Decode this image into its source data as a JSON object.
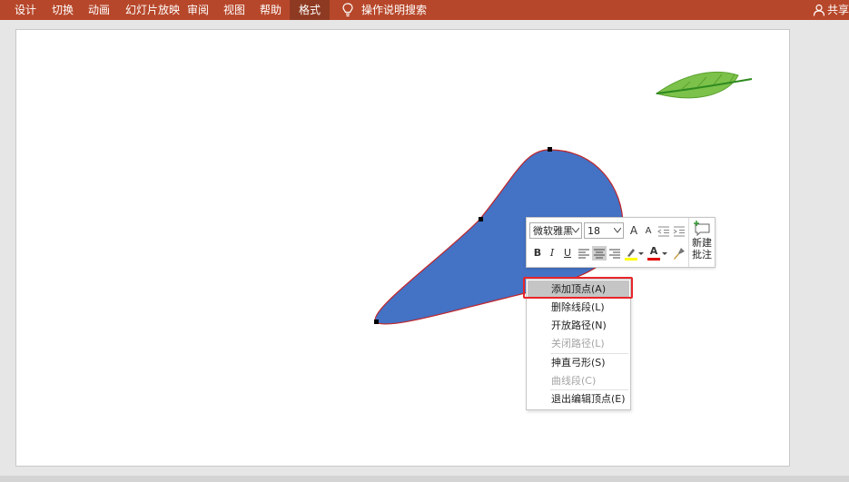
{
  "ribbon": {
    "tabs": [
      "设计",
      "切换",
      "动画",
      "幻灯片放映",
      "审阅",
      "视图",
      "帮助",
      "格式"
    ],
    "active_tab": "格式",
    "tell_me": "操作说明搜索",
    "share": "共享"
  },
  "colors": {
    "ribbon": "#b7472a",
    "shape_fill": "#4472c4",
    "shape_outline": "#c0262b",
    "highlight": "#e8262a",
    "leaf": "#7cc24a"
  },
  "mini_toolbar": {
    "font_name": "微软雅黑",
    "font_size": "18",
    "grow_font": "A",
    "shrink_font": "A",
    "bold": "B",
    "italic": "I",
    "underline": "U",
    "font_color": "A",
    "new_comment_line1": "新建",
    "new_comment_line2": "批注"
  },
  "context_menu": {
    "items": [
      {
        "label": "添加顶点(A)",
        "disabled": false,
        "hover": true
      },
      {
        "label": "删除线段(L)",
        "disabled": false
      },
      {
        "label": "开放路径(N)",
        "disabled": false
      },
      {
        "label": "关闭路径(L)",
        "disabled": true
      },
      {
        "label": "抻直弓形(S)",
        "disabled": false
      },
      {
        "label": "曲线段(C)",
        "disabled": true
      },
      {
        "label": "退出编辑顶点(E)",
        "disabled": false
      }
    ]
  }
}
